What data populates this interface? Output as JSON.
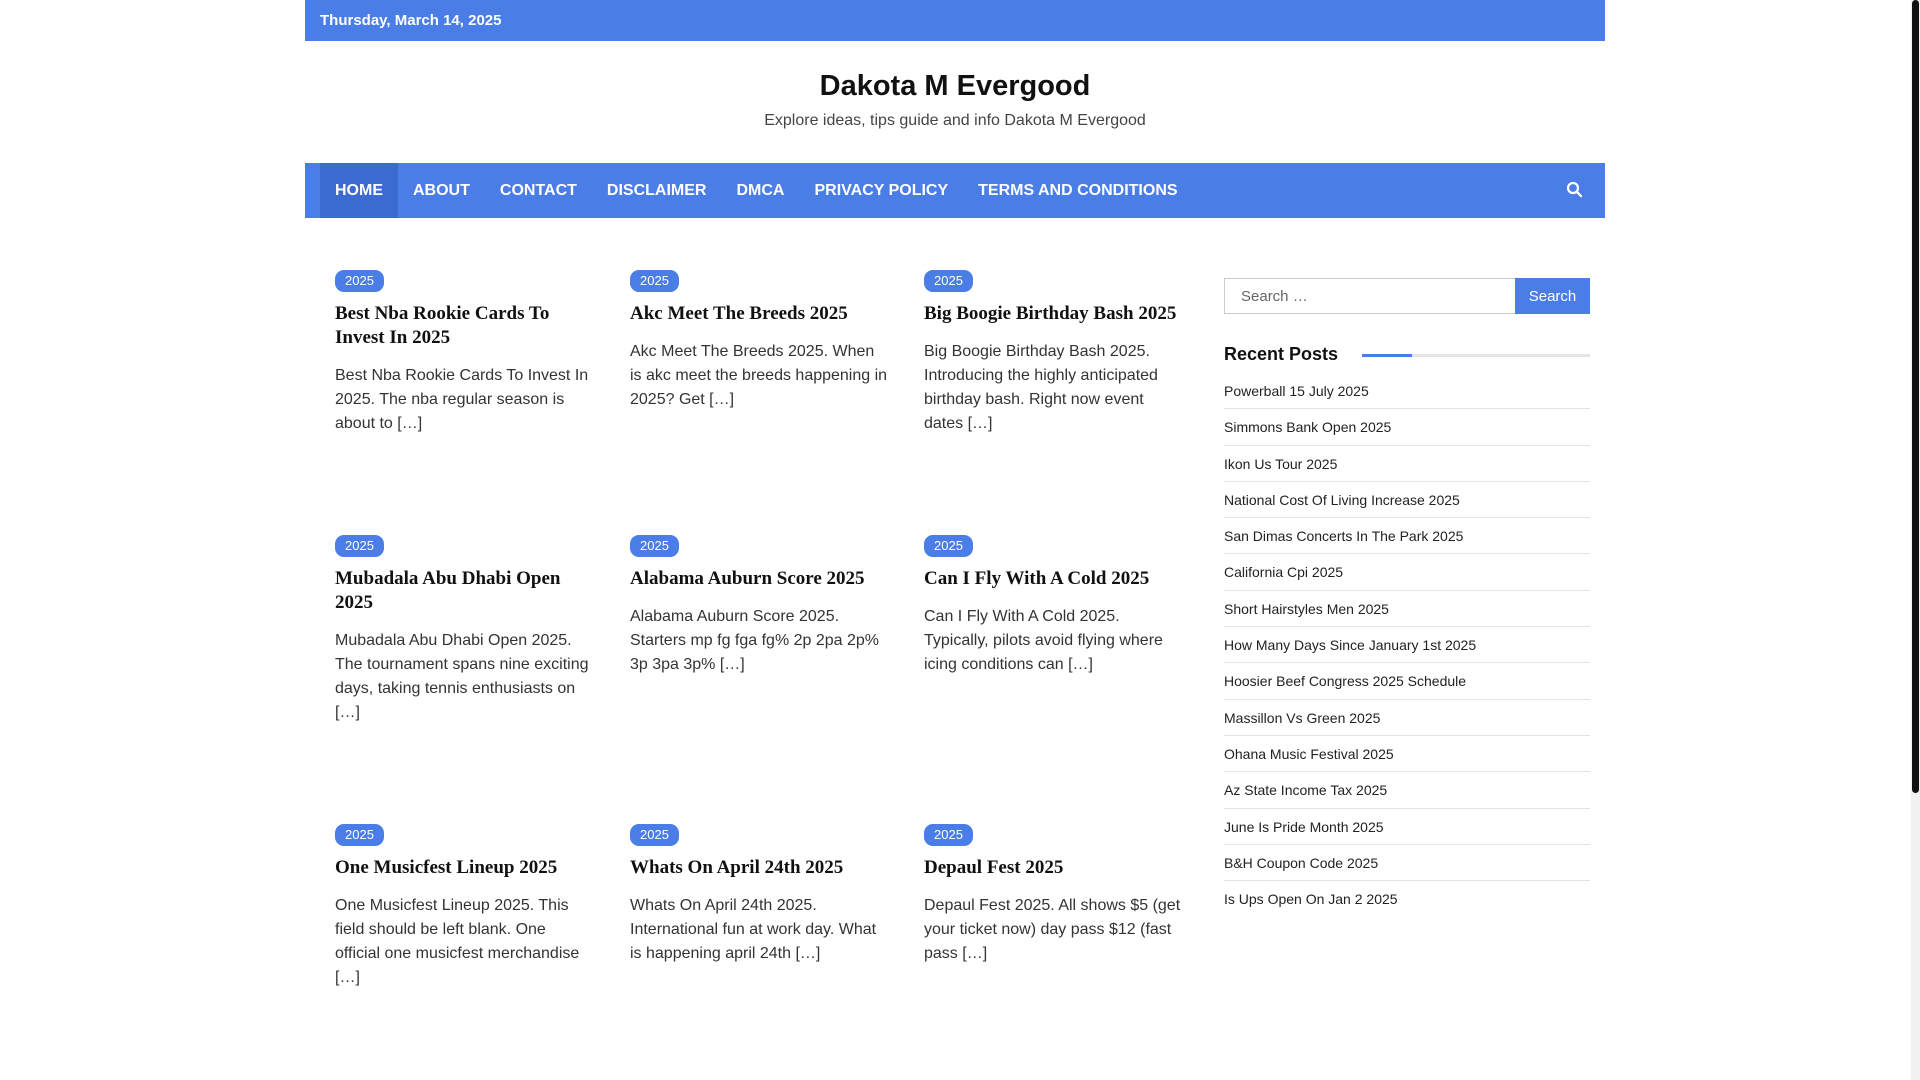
{
  "topbar": {
    "date": "Thursday, March 14, 2025"
  },
  "header": {
    "title": "Dakota M Evergood",
    "description": "Explore ideas, tips guide and info Dakota M Evergood"
  },
  "nav": {
    "items": [
      {
        "label": "HOME",
        "active": true
      },
      {
        "label": "ABOUT"
      },
      {
        "label": "CONTACT"
      },
      {
        "label": "DISCLAIMER"
      },
      {
        "label": "DMCA"
      },
      {
        "label": "PRIVACY POLICY"
      },
      {
        "label": "TERMS AND CONDITIONS"
      }
    ],
    "search_icon": "search-icon"
  },
  "posts": [
    {
      "category": "2025",
      "title": "Best Nba Rookie Cards To Invest In 2025",
      "excerpt": "Best Nba Rookie Cards To Invest In 2025. The nba regular season is about to […]"
    },
    {
      "category": "2025",
      "title": "Akc Meet The Breeds 2025",
      "excerpt": "Akc Meet The Breeds 2025. When is akc meet the breeds happening in 2025? Get […]"
    },
    {
      "category": "2025",
      "title": "Big Boogie Birthday Bash 2025",
      "excerpt": "Big Boogie Birthday Bash 2025. Introducing the highly anticipated birthday bash. Right now event dates […]"
    },
    {
      "category": "2025",
      "title": "Mubadala Abu Dhabi Open 2025",
      "excerpt": "Mubadala Abu Dhabi Open 2025. The tournament spans nine exciting days, taking tennis enthusiasts on […]"
    },
    {
      "category": "2025",
      "title": "Alabama Auburn Score 2025",
      "excerpt": "Alabama Auburn Score 2025. Starters mp fg fga fg% 2p 2pa 2p% 3p 3pa 3p% […]"
    },
    {
      "category": "2025",
      "title": "Can I Fly With A Cold 2025",
      "excerpt": "Can I Fly With A Cold 2025. Typically, pilots avoid flying where icing conditions can […]"
    },
    {
      "category": "2025",
      "title": "One Musicfest Lineup 2025",
      "excerpt": "One Musicfest Lineup 2025. This field should be left blank. One official one musicfest merchandise […]"
    },
    {
      "category": "2025",
      "title": "Whats On April 24th 2025",
      "excerpt": "Whats On April 24th 2025. International fun at work day. What is happening april 24th […]"
    },
    {
      "category": "2025",
      "title": "Depaul Fest 2025",
      "excerpt": "Depaul Fest 2025. All shows $5 (get your ticket now) day pass $12 (fast pass […]"
    }
  ],
  "sidebar": {
    "search": {
      "placeholder": "Search …",
      "button_label": "Search"
    },
    "recent_title": "Recent Posts",
    "recent_posts": [
      "Powerball 15 July 2025",
      "Simmons Bank Open 2025",
      "Ikon Us Tour 2025",
      "National Cost Of Living Increase 2025",
      "San Dimas Concerts In The Park 2025",
      "California Cpi 2025",
      "Short Hairstyles Men 2025",
      "How Many Days Since January 1st 2025",
      "Hoosier Beef Congress 2025 Schedule",
      "Massillon Vs Green 2025",
      "Ohana Music Festival 2025",
      "Az State Income Tax 2025",
      "June Is Pride Month 2025",
      "B&H Coupon Code 2025",
      "Is Ups Open On Jan 2 2025"
    ]
  },
  "colors": {
    "accent": "#4a7de5",
    "accent_dark": "#3b6bd1"
  }
}
